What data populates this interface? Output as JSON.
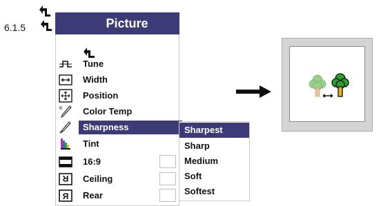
{
  "section": {
    "number": "6.1.5"
  },
  "panel": {
    "title": "Picture",
    "items": [
      {
        "label": "Tune",
        "icon": "tune-icon"
      },
      {
        "label": "Width",
        "icon": "width-icon"
      },
      {
        "label": "Position",
        "icon": "position-icon"
      },
      {
        "label": "Color Temp",
        "icon": "color-temp-icon"
      },
      {
        "label": "Sharpness",
        "icon": "sharpness-icon",
        "selected": true
      },
      {
        "label": "Tint",
        "icon": "tint-icon"
      },
      {
        "label": "16:9",
        "icon": "aspect-icon",
        "checkbox": false
      },
      {
        "label": "Ceiling",
        "icon": "ceiling-icon",
        "checkbox": false
      },
      {
        "label": "Rear",
        "icon": "rear-icon",
        "checkbox": false
      }
    ]
  },
  "submenu": {
    "items": [
      "Sharpest",
      "Sharp",
      "Medium",
      "Soft",
      "Softest"
    ],
    "selected": "Sharpest"
  },
  "colors": {
    "highlight": "#3d3a78",
    "panel_border": "#c9c9c9",
    "preview_frame": "#d4d4d4"
  }
}
